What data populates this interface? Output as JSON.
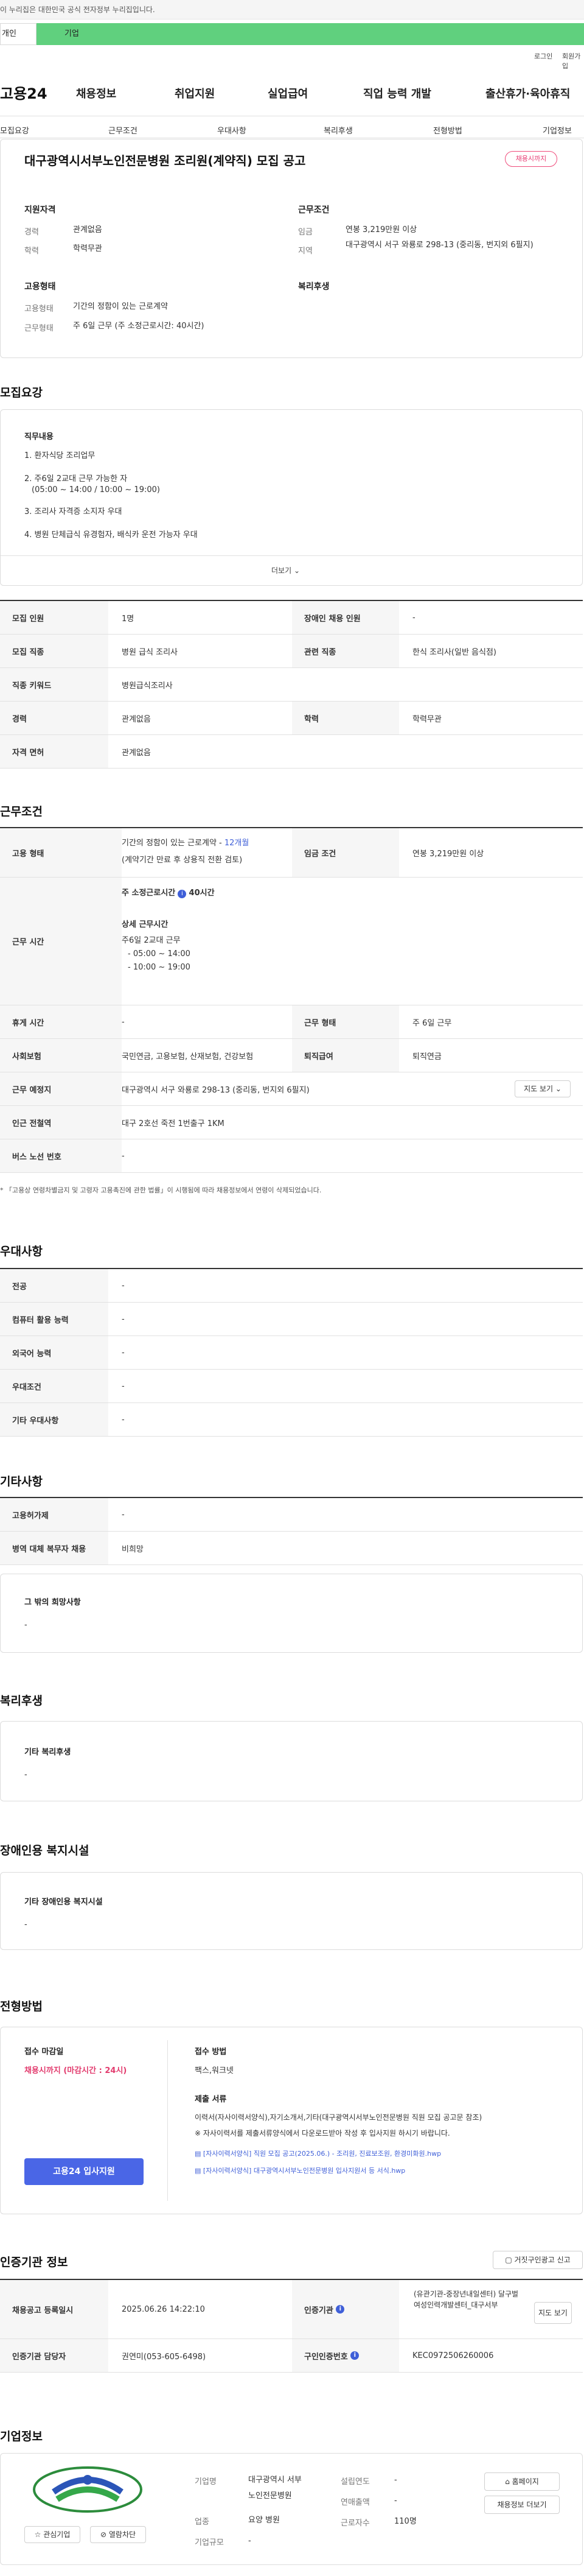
{
  "gov_banner": "이 누리집은 대한민국 공식 전자정부 누리집입니다.",
  "banner_tabs": [
    "개인",
    "기업"
  ],
  "util_links": [
    "로그인",
    "회원가입"
  ],
  "logo": "고용24",
  "gnb": [
    "채용정보",
    "취업지원",
    "실업급여",
    "직업 능력 개발",
    "출산휴가·육아휴직"
  ],
  "subnav": [
    "모집요강",
    "근무조건",
    "우대사항",
    "복리후생",
    "전형방법",
    "기업정보"
  ],
  "job": {
    "title": "대구광역시서부노인전문병원 조리원(계약직) 모집 공고",
    "badge": "채용시까지",
    "qual_heading": "지원자격",
    "career_label": "경력",
    "career_value": "관계없음",
    "edu_label": "학력",
    "edu_value": "학력무관",
    "emp_heading": "고용형태",
    "emp_label": "고용형태",
    "emp_value": "기간의 정함이 있는 근로계약",
    "work_label": "근무형태",
    "work_value": "주 6일 근무 (주 소정근로시간: 40시간)",
    "cond_heading": "근무조건",
    "wage_label": "임금",
    "wage_value": "연봉 3,219만원 이상",
    "region_label": "지역",
    "region_value": "대구광역시 서구 와룡로 298-13 (중리동, 번지외 6필지)",
    "welfare_heading": "복리후생"
  },
  "recruit": {
    "heading": "모집요강",
    "duty_heading": "직무내용",
    "duties": [
      "1. 환자식당 조리업무",
      "2. 주6일  2교대 근무 가능한 자",
      "(05:00 ~ 14:00 / 10:00 ~ 19:00)",
      "3. 조리사 자격증 소지자 우대",
      "4. 병원 단체급식 유경험자, 배식카 운전 가능자 우대"
    ],
    "more": "더보기",
    "rows": [
      {
        "k1": "모집 인원",
        "v1": "1명",
        "k2": "장애인 채용 인원",
        "v2": "-"
      },
      {
        "k1": "모집 직종",
        "v1": "병원 급식 조리사",
        "k2": "관련 직종",
        "v2": "한식 조리사(일반 음식점)"
      },
      {
        "k1": "직종 키워드",
        "v1": "병원급식조리사"
      },
      {
        "k1": "경력",
        "v1": "관계없음",
        "k2": "학력",
        "v2": "학력무관"
      },
      {
        "k1": "자격 면허",
        "v1": "관계없음"
      }
    ]
  },
  "conditions": {
    "heading": "근무조건",
    "emp_k": "고용 형태",
    "emp_v1": "기간의 정함이 있는 근로계약",
    "emp_dash": " - ",
    "emp_months": "12개월",
    "emp_v2": "(계약기간 만료 후 상용직 전환 검토)",
    "wage_k": "임금 조건",
    "wage_v": "연봉 3,219만원 이상",
    "hours_k": "근무 시간",
    "hours_t1": "주 소정근로시간",
    "hours_t1v": "40시간",
    "hours_t2": "상세 근무시간",
    "hours_lines": [
      "주6일 2교대 근무",
      "- 05:00 ~ 14:00",
      "- 10:00 ~ 19:00"
    ],
    "break_k": "휴게 시간",
    "break_v": "-",
    "form_k": "근무 형태",
    "form_v": "주 6일 근무",
    "ins_k": "사회보험",
    "ins_v": "국민연금, 고용보험, 산재보험, 건강보험",
    "ret_k": "퇴직급여",
    "ret_v": "퇴직연금",
    "place_k": "근무 예정지",
    "place_v": "대구광역시 서구 와룡로 298-13 (중리동, 번지외 6필지)",
    "map_btn": "지도 보기",
    "subway_k": "인근 전철역",
    "subway_v": "대구 2호선 죽전 1번출구 1KM",
    "bus_k": "버스 노선 번호",
    "bus_v": "-",
    "note": "* 「고용상 연령차별금지 및 고령자 고용촉진에 관한 법률」이 시행됨에 따라 채용정보에서 연령이 삭제되었습니다."
  },
  "preference": {
    "heading": "우대사항",
    "rows": [
      {
        "k": "전공",
        "v": "-"
      },
      {
        "k": "컴퓨터 활용 능력",
        "v": "-"
      },
      {
        "k": "외국어 능력",
        "v": "-"
      },
      {
        "k": "우대조건",
        "v": "-"
      },
      {
        "k": "기타 우대사항",
        "v": "-"
      }
    ]
  },
  "other": {
    "heading": "기타사항",
    "rows": [
      {
        "k": "고용허가제",
        "v": "-"
      },
      {
        "k": "병역 대체 복무자 채용",
        "v": "비희망"
      }
    ],
    "extra_title": "그 밖의 희망사항",
    "extra_v": "-"
  },
  "welfare": {
    "heading": "복리후생",
    "box_title": "기타 복리후생",
    "box_v": "-"
  },
  "disability": {
    "heading": "장애인용 복지시설",
    "box_title": "기타 장애인용 복지시설",
    "box_v": "-"
  },
  "selection": {
    "heading": "전형방법",
    "deadline_k": "접수 마감일",
    "deadline_v": "채용시까지 (마감시간 : 24시)",
    "apply_btn": "고용24 입사지원",
    "method_k": "접수 방법",
    "method_v": "팩스,워크넷",
    "docs_k": "제출 서류",
    "docs_v1": "이력서(자사이력서양식),자기소개서,기타(대구광역시서부노인전문병원 직원 모집 공고문 참조)",
    "docs_v2": "※ 자사이력서를 제출서류양식에서 다운로드받아 작성 후 입사지원 하시기 바랍니다.",
    "file1": "[자사이력서양식] 직원 모집 공고(2025.06.) - 조리원, 진료보조원, 환경미화원.hwp",
    "file2": "[자사이력서양식] 대구광역시서부노인전문병원 입사지원서 등 서식.hwp"
  },
  "cert": {
    "heading": "인증기관 정보",
    "report_btn": "거짓구인광고 신고",
    "reg_k": "채용공고 등록일시",
    "reg_v": "2025.06.26 14:22:10",
    "org_k": "인증기관",
    "org_v": "(유관기관-중장년내일센터) 달구벌여성인력개발센터_대구서부",
    "org_btn": "지도 보기",
    "staff_k": "인증기관 담당자",
    "staff_v": "권연미(053-605-6498)",
    "no_k": "구인인증번호",
    "no_v": "KEC0972506260006"
  },
  "company": {
    "heading": "기업정보",
    "fav_btn": "관심기업",
    "block_btn": "열람차단",
    "name_k": "기업명",
    "name_v1": "대구광역시 서부",
    "name_v2": "노인전문병원",
    "ind_k": "업종",
    "ind_v": "요양 병원",
    "size_k": "기업규모",
    "size_v": "-",
    "est_k": "설립연도",
    "est_v": "-",
    "sales_k": "연매출액",
    "sales_v": "-",
    "emp_k": "근로자수",
    "emp_v": "110명",
    "home_btn": "홈페이지",
    "more_btn": "채용정보 더보기"
  }
}
